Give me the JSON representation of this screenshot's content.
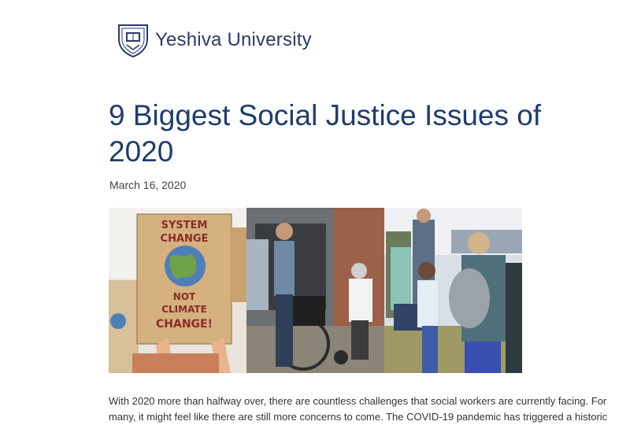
{
  "header": {
    "brand": "Yeshiva University",
    "logo_icon": "yu-shield-icon",
    "brand_color": "#2a3a6b"
  },
  "article": {
    "title": "9 Biggest Social Justice Issues of 2020",
    "date": "March 16, 2020",
    "title_color": "#1f3c6e",
    "hero_image": {
      "sign_text_1": "SYSTEM",
      "sign_text_2": "CHANGE",
      "sign_text_3": "NOT",
      "sign_text_4": "CLIMATE",
      "sign_text_5": "CHANGE!"
    },
    "intro_line_1": "With 2020 more than halfway over, there are countless challenges that social workers are currently facing. For",
    "intro_line_2": "many, it might feel like there are still more concerns to come. The COVID-19 pandemic has triggered a historic"
  }
}
